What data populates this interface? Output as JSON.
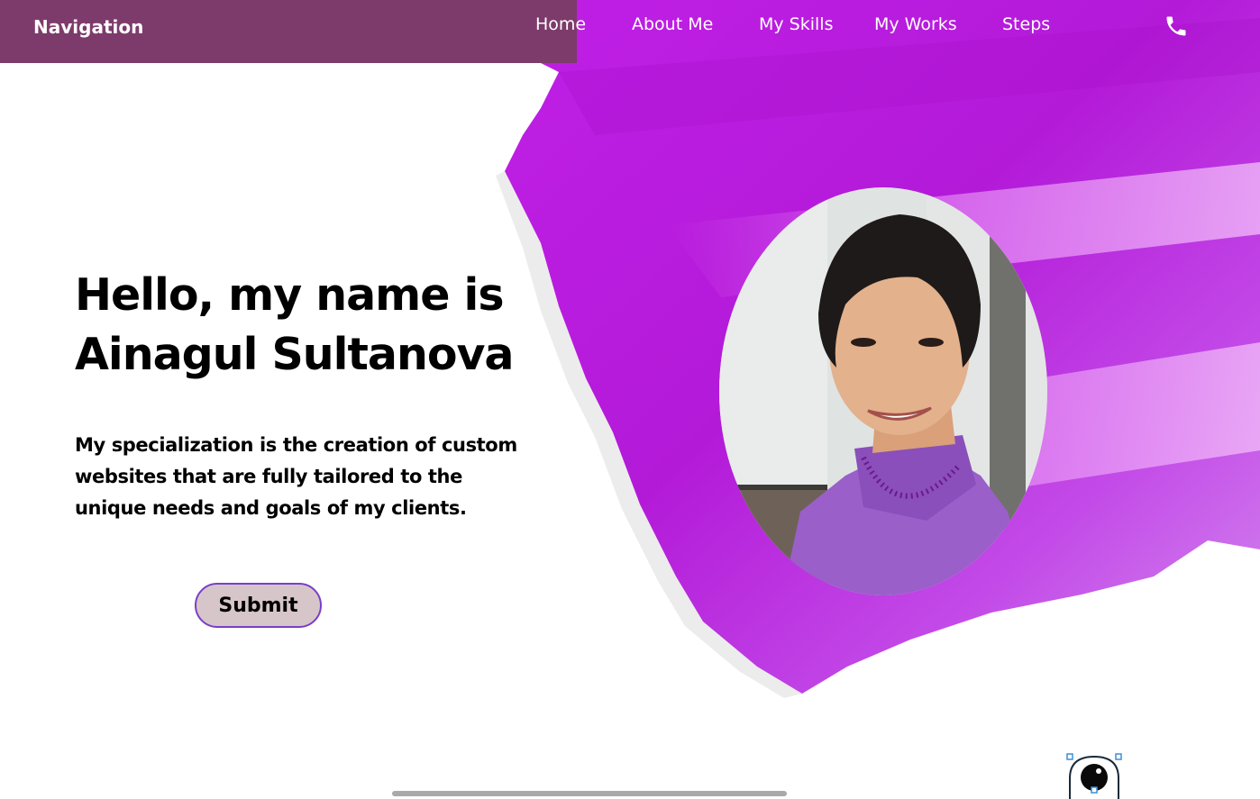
{
  "nav": {
    "brand": "Navigation",
    "links": [
      {
        "label": "Home"
      },
      {
        "label": "About Me"
      },
      {
        "label": "My Skills"
      },
      {
        "label": "My Works"
      },
      {
        "label": "Steps"
      }
    ],
    "phone_icon": "phone-icon"
  },
  "hero": {
    "title_line1": "Hello, my name is",
    "title_line2": "Ainagul Sultanova",
    "subtitle_line1": "My specialization is the creation of custom",
    "subtitle_line2": "websites that are fully tailored to the",
    "subtitle_line3": "unique needs and goals of my clients.",
    "button_label": "Submit"
  },
  "portrait": {
    "icon": "profile-photo"
  },
  "decor": {
    "widget_icon": "eye-widget-icon",
    "brush": "purple-paint-brush-stroke"
  },
  "colors": {
    "nav_bg": "#7d3b6b",
    "brush_purple": "#b71ee0",
    "brush_magenta": "#d43ce6",
    "button_bg": "#d7c6c9",
    "button_border": "#7a3fc6",
    "sweater": "#9a5fc9"
  }
}
